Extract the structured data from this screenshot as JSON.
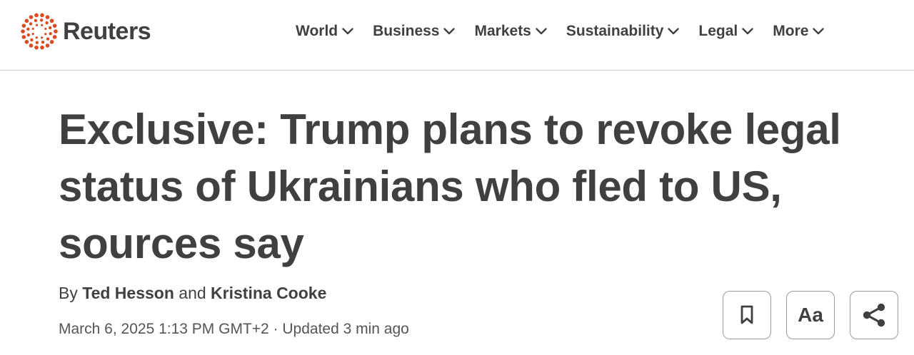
{
  "brand": {
    "name": "Reuters",
    "logo_icon": "reuters-dot-ring-icon",
    "accent_color": "#dc4a21"
  },
  "nav": {
    "items": [
      {
        "label": "World",
        "icon": "chevron-down-icon"
      },
      {
        "label": "Business",
        "icon": "chevron-down-icon"
      },
      {
        "label": "Markets",
        "icon": "chevron-down-icon"
      },
      {
        "label": "Sustainability",
        "icon": "chevron-down-icon"
      },
      {
        "label": "Legal",
        "icon": "chevron-down-icon"
      },
      {
        "label": "More",
        "icon": "chevron-down-icon"
      }
    ]
  },
  "article": {
    "headline": "Exclusive: Trump plans to revoke legal status of Ukrainians who fled to US, sources say",
    "byline_prefix": "By",
    "byline_joiner": "and",
    "authors": [
      "Ted Hesson",
      "Kristina Cooke"
    ],
    "dateline": "March 6, 2025 1:13 PM GMT+2 · Updated 3 min ago"
  },
  "actions": {
    "bookmark_icon": "bookmark-icon",
    "text_size_label": "Aa",
    "share_icon": "share-icon"
  }
}
